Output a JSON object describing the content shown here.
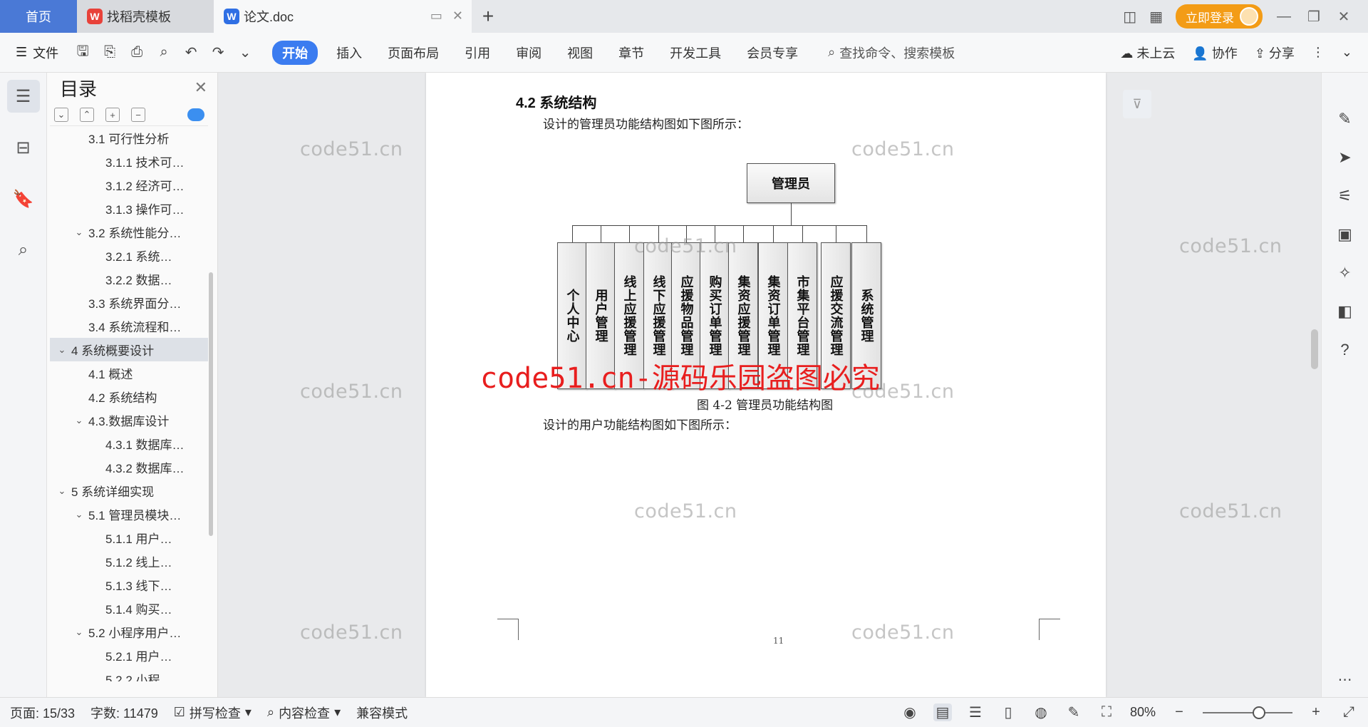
{
  "tabs": {
    "home": "首页",
    "template": "找稻壳模板",
    "doc": "论文.doc",
    "login": "立即登录"
  },
  "ribbon": {
    "file": "文件",
    "tabs": [
      "开始",
      "插入",
      "页面布局",
      "引用",
      "审阅",
      "视图",
      "章节",
      "开发工具",
      "会员专享"
    ],
    "active_tab": "开始",
    "search_placeholder": "查找命令、搜索模板",
    "cloud": "未上云",
    "collab": "协作",
    "share": "分享"
  },
  "toc": {
    "title": "目录",
    "items": [
      {
        "label": "3.1 可行性分析",
        "level": 2,
        "arrow": ""
      },
      {
        "label": "3.1.1 技术可…",
        "level": 3,
        "arrow": ""
      },
      {
        "label": "3.1.2 经济可…",
        "level": 3,
        "arrow": ""
      },
      {
        "label": "3.1.3 操作可…",
        "level": 3,
        "arrow": ""
      },
      {
        "label": "3.2 系统性能分…",
        "level": 2,
        "arrow": "∨"
      },
      {
        "label": "3.2.1 系统…",
        "level": 3,
        "arrow": ""
      },
      {
        "label": "3.2.2 数据…",
        "level": 3,
        "arrow": ""
      },
      {
        "label": "3.3 系统界面分…",
        "level": 2,
        "arrow": ""
      },
      {
        "label": "3.4 系统流程和…",
        "level": 2,
        "arrow": ""
      },
      {
        "label": "4 系统概要设计",
        "level": 1,
        "arrow": "∨",
        "active": true
      },
      {
        "label": "4.1 概述",
        "level": 2,
        "arrow": ""
      },
      {
        "label": "4.2 系统结构",
        "level": 2,
        "arrow": ""
      },
      {
        "label": "4.3.数据库设计",
        "level": 2,
        "arrow": "∨"
      },
      {
        "label": "4.3.1 数据库…",
        "level": 3,
        "arrow": ""
      },
      {
        "label": "4.3.2 数据库…",
        "level": 3,
        "arrow": ""
      },
      {
        "label": "5 系统详细实现",
        "level": 1,
        "arrow": "∨"
      },
      {
        "label": "5.1 管理员模块…",
        "level": 2,
        "arrow": "∨"
      },
      {
        "label": "5.1.1 用户…",
        "level": 3,
        "arrow": ""
      },
      {
        "label": "5.1.2 线上…",
        "level": 3,
        "arrow": ""
      },
      {
        "label": "5.1.3 线下…",
        "level": 3,
        "arrow": ""
      },
      {
        "label": "5.1.4 购买…",
        "level": 3,
        "arrow": ""
      },
      {
        "label": "5.2 小程序用户…",
        "level": 2,
        "arrow": "∨"
      },
      {
        "label": "5.2.1 用户…",
        "level": 3,
        "arrow": ""
      },
      {
        "label": "5.2.2 小程…",
        "level": 3,
        "arrow": ""
      }
    ]
  },
  "document": {
    "heading": "4.2 系统结构",
    "para1": "设计的管理员功能结构图如下图所示：",
    "chart_root": "管理员",
    "chart_children": [
      "个人中心",
      "用户管理",
      "线上应援管理",
      "线下应援管理",
      "应援物品管理",
      "购买订单管理",
      "集资应援管理",
      "集资订单管理",
      "市集平台管理",
      "应援交流管理",
      "系统管理"
    ],
    "caption": "图 4-2 管理员功能结构图",
    "para2": "设计的用户功能结构图如下图所示：",
    "page_number": "11"
  },
  "watermark": {
    "text": "code51.cn",
    "red_text": "code51.cn-源码乐园盗图必究"
  },
  "status": {
    "page": "页面: 15/33",
    "words": "字数: 11479",
    "spell": "拼写检查",
    "content": "内容检查",
    "compat": "兼容模式",
    "zoom": "80%"
  },
  "colors": {
    "accent": "#3b7cf0",
    "home_tab": "#4a79d6",
    "login": "#f39c16",
    "watermark_red": "#e81e1e"
  }
}
